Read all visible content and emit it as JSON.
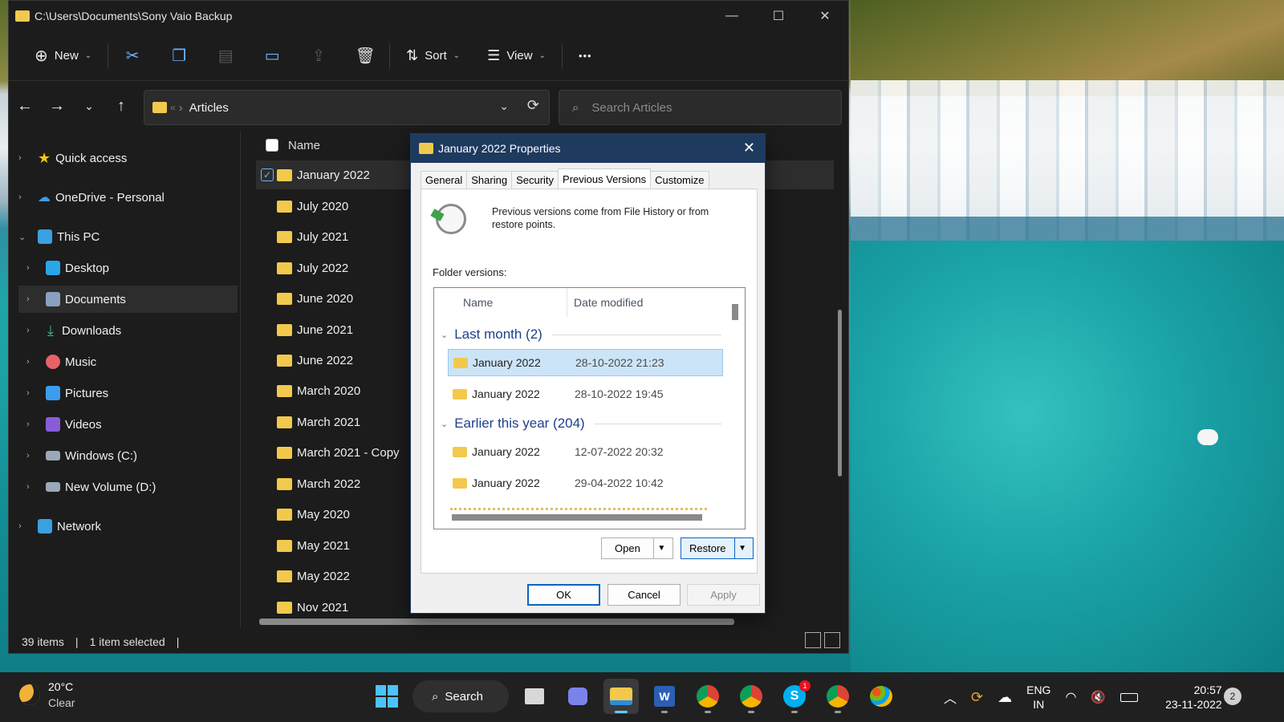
{
  "explorer": {
    "title_path": "C:\\Users\\Documents\\Sony Vaio Backup",
    "toolbar": {
      "new_label": "New",
      "sort_label": "Sort",
      "view_label": "View",
      "more_label": "•••"
    },
    "address": {
      "crumb_prefix": "«",
      "crumb": "Articles"
    },
    "search_placeholder": "Search Articles",
    "nav": [
      {
        "label": "Quick access",
        "icon": "star-icon",
        "color": "#f5c518"
      },
      {
        "label": "OneDrive - Personal",
        "icon": "cloud-icon",
        "color": "#3b9cf0"
      },
      {
        "label": "This PC",
        "icon": "computer-icon",
        "color": "#3aa0e0"
      },
      {
        "label": "Desktop",
        "icon": "desktop-icon",
        "color": "#2aa6e8"
      },
      {
        "label": "Documents",
        "icon": "documents-icon",
        "color": "#8aa0c0"
      },
      {
        "label": "Downloads",
        "icon": "download-icon",
        "color": "#35c08a"
      },
      {
        "label": "Music",
        "icon": "music-icon",
        "color": "#e8626a"
      },
      {
        "label": "Pictures",
        "icon": "pictures-icon",
        "color": "#3b9cf0"
      },
      {
        "label": "Videos",
        "icon": "videos-icon",
        "color": "#8a5cd8"
      },
      {
        "label": "Windows (C:)",
        "icon": "drive-icon",
        "color": "#9aa8b8"
      },
      {
        "label": "New Volume (D:)",
        "icon": "drive-icon",
        "color": "#9aa8b8"
      },
      {
        "label": "Network",
        "icon": "network-icon",
        "color": "#3aa0e0"
      }
    ],
    "column_name": "Name",
    "files": [
      "January 2022",
      "July 2020",
      "July 2021",
      "July 2022",
      "June 2020",
      "June 2021",
      "June 2022",
      "March 2020",
      "March 2021",
      "March 2021 - Copy",
      "March 2022",
      "May 2020",
      "May 2021",
      "May 2022",
      "Nov 2021"
    ],
    "status": {
      "items": "39 items",
      "selected": "1 item selected"
    }
  },
  "dialog": {
    "title": "January 2022 Properties",
    "tabs": [
      "General",
      "Sharing",
      "Security",
      "Previous Versions",
      "Customize"
    ],
    "description": "Previous versions come from File History or from restore points.",
    "folder_versions_label": "Folder versions:",
    "col_name": "Name",
    "col_date": "Date modified",
    "groups": [
      {
        "title": "Last month (2)",
        "rows": [
          {
            "name": "January 2022",
            "date": "28-10-2022 21:23"
          },
          {
            "name": "January 2022",
            "date": "28-10-2022 19:45"
          }
        ]
      },
      {
        "title": "Earlier this year (204)",
        "rows": [
          {
            "name": "January 2022",
            "date": "12-07-2022 20:32"
          },
          {
            "name": "January 2022",
            "date": "29-04-2022 10:42"
          }
        ]
      }
    ],
    "open_label": "Open",
    "restore_label": "Restore",
    "ok_label": "OK",
    "cancel_label": "Cancel",
    "apply_label": "Apply"
  },
  "taskbar": {
    "weather_temp": "20°C",
    "weather_cond": "Clear",
    "search_label": "Search",
    "skype_badge": "1",
    "lang_top": "ENG",
    "lang_bottom": "IN",
    "time": "20:57",
    "date": "23-11-2022",
    "notifications": "2"
  }
}
